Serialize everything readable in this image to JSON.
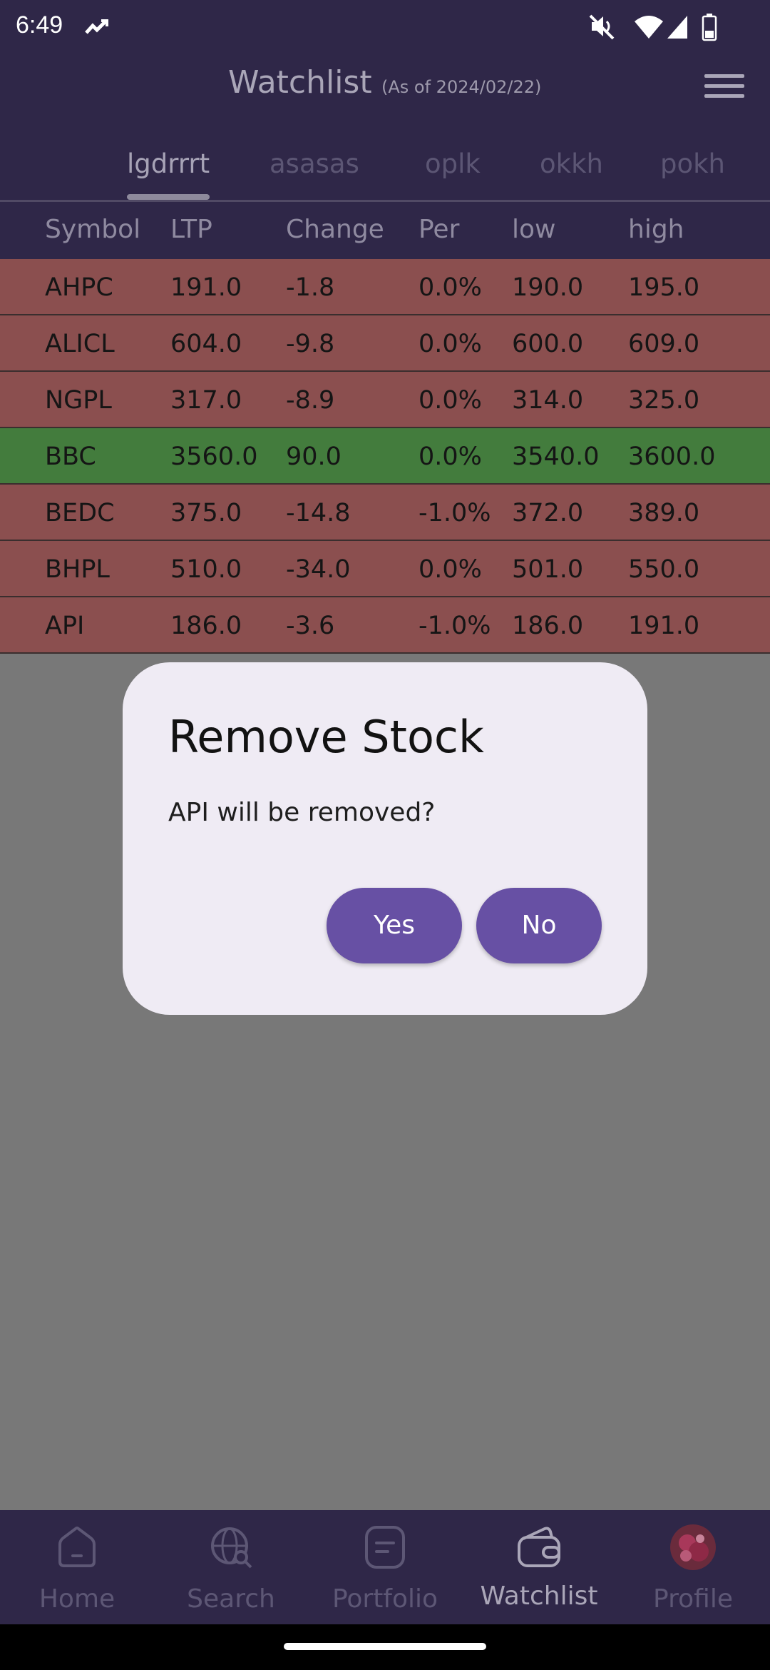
{
  "status_bar": {
    "time": "6:49",
    "icons": [
      "stock-trend-icon",
      "mute-icon",
      "wifi-icon",
      "signal-icon",
      "battery-icon"
    ]
  },
  "header": {
    "title": "Watchlist",
    "as_of": "(As of 2024/02/22)",
    "menu_icon": "hamburger-menu-icon"
  },
  "tabs": [
    {
      "label": "lgdrrrt",
      "active": true
    },
    {
      "label": "asasas",
      "active": false
    },
    {
      "label": "oplk",
      "active": false
    },
    {
      "label": "okkh",
      "active": false
    },
    {
      "label": "pokh",
      "active": false
    }
  ],
  "table": {
    "columns": [
      "Symbol",
      "LTP",
      "Change",
      "Per",
      "low",
      "high"
    ],
    "rows": [
      {
        "trend": "down",
        "cells": [
          "AHPC",
          "191.0",
          "-1.8",
          "0.0%",
          "190.0",
          "195.0"
        ]
      },
      {
        "trend": "down",
        "cells": [
          "ALICL",
          "604.0",
          "-9.8",
          "0.0%",
          "600.0",
          "609.0"
        ]
      },
      {
        "trend": "down",
        "cells": [
          "NGPL",
          "317.0",
          "-8.9",
          "0.0%",
          "314.0",
          "325.0"
        ]
      },
      {
        "trend": "up",
        "cells": [
          "BBC",
          "3560.0",
          "90.0",
          "0.0%",
          "3540.0",
          "3600.0"
        ]
      },
      {
        "trend": "down",
        "cells": [
          "BEDC",
          "375.0",
          "-14.8",
          "-1.0%",
          "372.0",
          "389.0"
        ]
      },
      {
        "trend": "down",
        "cells": [
          "BHPL",
          "510.0",
          "-34.0",
          "0.0%",
          "501.0",
          "550.0"
        ]
      },
      {
        "trend": "down",
        "cells": [
          "API",
          "186.0",
          "-3.6",
          "-1.0%",
          "186.0",
          "191.0"
        ]
      }
    ]
  },
  "dialog": {
    "title": "Remove Stock",
    "message": "API will be removed?",
    "yes_label": "Yes",
    "no_label": "No"
  },
  "bottom_nav": [
    {
      "label": "Home",
      "icon": "home-icon",
      "active": false
    },
    {
      "label": "Search",
      "icon": "globe-search-icon",
      "active": false
    },
    {
      "label": "Portfolio",
      "icon": "portfolio-icon",
      "active": false
    },
    {
      "label": "Watchlist",
      "icon": "wallet-icon",
      "active": true
    },
    {
      "label": "Profile",
      "icon": "avatar",
      "active": false
    }
  ],
  "colors": {
    "bar_bg": "#2f2748",
    "row_down": "#8b4f4f",
    "row_up": "#437c3d",
    "scrim": "#787878",
    "dialog_bg": "#efebf4",
    "button": "#6750a4"
  }
}
